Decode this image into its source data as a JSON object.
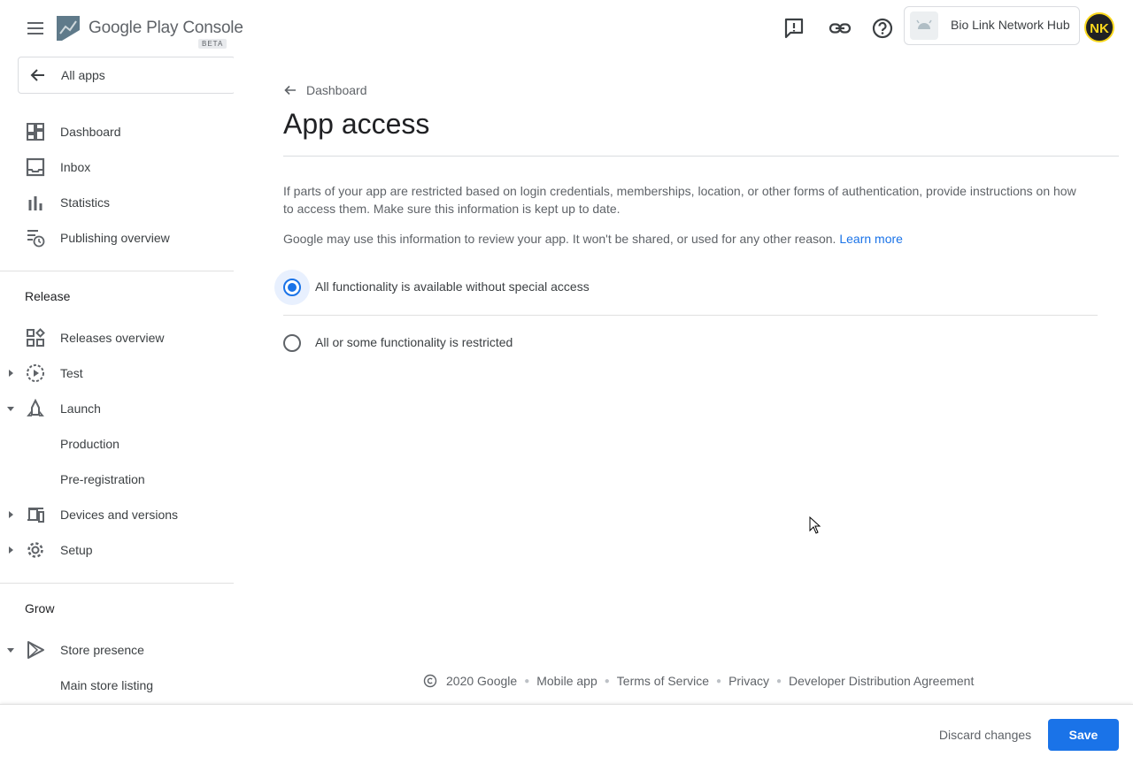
{
  "header": {
    "menu_icon": "hamburger-menu-icon",
    "logo_text": "Google Play Console",
    "logo_badge": "BETA",
    "icons": [
      "feedback-icon",
      "link-icon",
      "help-icon"
    ],
    "app_name": "Bio Link Network Hub",
    "avatar_initials": "NK"
  },
  "sidebar": {
    "all_apps_label": "All apps",
    "top_items": [
      {
        "label": "Dashboard",
        "icon": "dashboard-icon"
      },
      {
        "label": "Inbox",
        "icon": "inbox-icon"
      },
      {
        "label": "Statistics",
        "icon": "bar-chart-icon"
      },
      {
        "label": "Publishing overview",
        "icon": "publishing-overview-icon"
      }
    ],
    "release_title": "Release",
    "release_items": [
      {
        "label": "Releases overview",
        "icon": "releases-overview-icon"
      },
      {
        "label": "Test",
        "icon": "test-icon",
        "expandable": true,
        "expanded": false
      },
      {
        "label": "Launch",
        "icon": "launch-icon",
        "expandable": true,
        "expanded": true
      },
      {
        "label": "Production"
      },
      {
        "label": "Pre-registration"
      },
      {
        "label": "Devices and versions",
        "icon": "devices-icon",
        "expandable": true,
        "expanded": false
      },
      {
        "label": "Setup",
        "icon": "gear-icon",
        "expandable": true,
        "expanded": false
      }
    ],
    "grow_title": "Grow",
    "grow_items": [
      {
        "label": "Store presence",
        "icon": "play-store-icon",
        "expandable": true,
        "expanded": true
      },
      {
        "label": "Main store listing"
      }
    ]
  },
  "main": {
    "breadcrumb": "Dashboard",
    "title": "App access",
    "description": "If parts of your app are restricted based on login credentials, memberships, location, or other forms of authentication, provide instructions on how to access them. Make sure this information is kept up to date.",
    "note": "Google may use this information to review your app. It won't be shared, or used for any other reason.",
    "learn_more": "Learn more",
    "options": [
      {
        "label": "All functionality is available without special access",
        "selected": true
      },
      {
        "label": "All or some functionality is restricted",
        "selected": false
      }
    ]
  },
  "footer": {
    "copyright": "2020 Google",
    "links": [
      "Mobile app",
      "Terms of Service",
      "Privacy",
      "Developer Distribution Agreement"
    ]
  },
  "actions": {
    "discard_label": "Discard changes",
    "save_label": "Save"
  },
  "colors": {
    "accent": "#1a73e8",
    "text_primary": "#202124",
    "text_secondary": "#5f6368",
    "avatar_bg": "#202124",
    "avatar_fg": "#f9d71c"
  }
}
